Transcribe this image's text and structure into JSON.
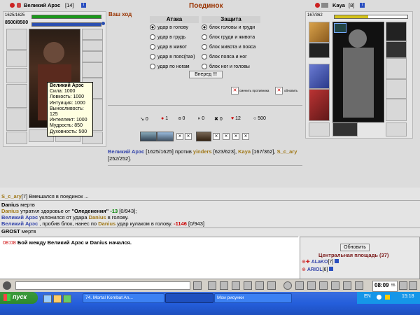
{
  "header": {
    "title": "Поединок",
    "your_move": "Ваш ход"
  },
  "left_player": {
    "name": "Великий Арэс",
    "level": "[14]",
    "hp": "1625/1625",
    "mana": "8500/8500",
    "hp_fraction": 1.0,
    "mana_fraction": 1.0
  },
  "right_player": {
    "name": "Kaya",
    "level": "[8]",
    "hp": "167/362",
    "hp_fraction": 0.46
  },
  "tooltip": {
    "lines": [
      "Великий Арэс",
      "Сила: 1000",
      "Ловкость: 1000",
      "Интуиция: 1000",
      "Выносливость: 125",
      "Интеллект: 1000",
      "Мудрость: 850",
      "Духовность: 500"
    ]
  },
  "attack": {
    "header": "Атака",
    "options": [
      "удар в голову",
      "удар в грудь",
      "удар в живот",
      "удар в пояс(пах)",
      "удар по ногам"
    ],
    "selected": 0
  },
  "defense": {
    "header": "Защита",
    "options": [
      "блок головы и груди",
      "блок груди и живота",
      "блок живота и пояса",
      "блок пояса и ног",
      "блок ног и головы"
    ],
    "selected": 0
  },
  "forward_button": "Вперед !!!",
  "buttons": {
    "change_opponent": "сменить противника",
    "refresh": "обновить"
  },
  "stats_row": [
    {
      "icon": "slash-icon",
      "value": "0"
    },
    {
      "icon": "drop-icon",
      "value": "1"
    },
    {
      "icon": "strike-icon",
      "value": "0"
    },
    {
      "icon": "shield-icon",
      "value": "0"
    },
    {
      "icon": "cross-icon",
      "value": "0"
    },
    {
      "icon": "heart-icon",
      "value": "12"
    },
    {
      "icon": "ring-icon",
      "value": "500"
    }
  ],
  "battle_summary": {
    "p1": "Великий Арэс",
    "p1_hp": "[1625/1625]",
    "vs": "против",
    "p2": "yinders",
    "p2_hp": "[623/623]",
    "p3": "Kaya",
    "p3_hp": "[167/362]",
    "p4": "S_c_ary",
    "p4_hp": "[252/252]."
  },
  "log": {
    "l1_name": "S_c_ary",
    "l1_lvl": "[7]",
    "l1_text": "Вмешался в поединок ...",
    "l2_name": "Danius",
    "l2_text": "мертв",
    "l3_name": "Danius",
    "l3_text": "утратил здоровье от",
    "l3_spell": "\"Оледенения\"",
    "l3_val": "-13",
    "l3_hp": "[0/943];",
    "l4_name": "Великий Арэс",
    "l4_text": "уклонился от удара",
    "l4_name2": "Danius",
    "l4_text2": "в голову.",
    "l5_name": "Великий Арэс",
    "l5_text": ", пробив блок, нанес по",
    "l5_name2": "Danius",
    "l5_text2": "удар кулаком в голову.",
    "l5_val": "-1146",
    "l5_hp": "[0/943]",
    "l6_name": "GROST",
    "l6_text": "мертв"
  },
  "chat": {
    "time": "08:08",
    "text": "Бой между",
    "name1": "Великий Арэс",
    "and": "и",
    "name2": "Danius",
    "end": "начался."
  },
  "online": {
    "button": "Обновить",
    "place": "Центральная площадь (37)",
    "users": [
      {
        "name": "ALaKO",
        "level": "[7]"
      },
      {
        "name": "ARIOL",
        "level": "[6]"
      }
    ]
  },
  "status_bar": {
    "time": "08:09",
    "seconds": "55"
  },
  "taskbar": {
    "start": "пуск",
    "items": [
      "74. Mortal Kombat An...",
      "",
      "Мои рисунки"
    ],
    "lang": "EN",
    "clock": "15:18"
  }
}
